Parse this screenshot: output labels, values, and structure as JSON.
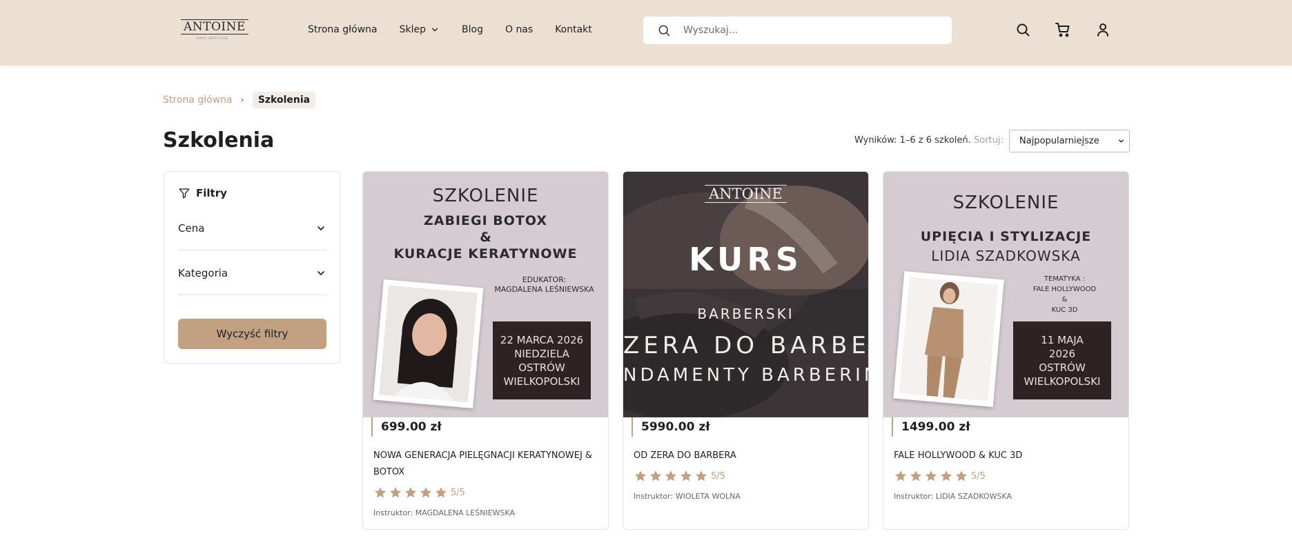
{
  "header": {
    "logo_text": "ANTOINE",
    "logo_subtext": "HAIR INSTITUTE",
    "nav": [
      "Strona główna",
      "Sklep",
      "Blog",
      "O nas",
      "Kontakt"
    ],
    "search_placeholder": "Wyszukaj...",
    "icons": [
      "search-icon",
      "cart-icon",
      "user-icon"
    ]
  },
  "breadcrumb": {
    "home": "Strona główna",
    "current": "Szkolenia"
  },
  "page_title": "Szkolenia",
  "toolbar": {
    "results_text": "Wyników: 1–6 z 6 szkoleń.",
    "sort_label": "Sortuj:",
    "sort_value": "Najpopularniejsze"
  },
  "filters": {
    "title": "Filtry",
    "price_label": "Cena",
    "category_label": "Kategoria",
    "clear_label": "Wyczyść filtry"
  },
  "colors": {
    "header_bg": "#ece0d3",
    "accent": "#c2a082",
    "star": "#c2a082"
  },
  "products": [
    {
      "price": "699.00 zł",
      "title": "NOWA GENERACJA PIELĘGNACJI KERATYNOWEJ & BOTOX",
      "rating": "5/5",
      "stars": 5,
      "instructor": "Instruktor: MAGDALENA LEŚNIEWSKA",
      "poster": {
        "heading": "SZKOLENIE",
        "line1": "ZABIEGI BOTOX",
        "line2": "&",
        "line3": "KURACJE KERATYNOWE",
        "educator_label": "EDUKATOR:",
        "educator_name": "MAGDALENA LEŚNIEWSKA",
        "date": [
          "22 MARCA 2026",
          "NIEDZIELA",
          "OSTRÓW",
          "WIELKOPOLSKI"
        ]
      }
    },
    {
      "price": "5990.00 zł",
      "title": "OD ZERA DO BARBERA",
      "rating": "5/5",
      "stars": 5,
      "instructor": "Instruktor: WIOLETA WOLNA",
      "poster": {
        "logo": "ANTOINE",
        "heading": "KURS",
        "line1": "BARBERSKI",
        "line2": "ZERA DO BARBE",
        "line3": "NDAMENTY BARBERIN"
      }
    },
    {
      "price": "1499.00 zł",
      "title": "FALE HOLLYWOOD & KUC 3D",
      "rating": "5/5",
      "stars": 5,
      "instructor": "Instruktor: LIDIA SZADKOWSKA",
      "poster": {
        "heading": "SZKOLENIE",
        "line1": "UPIĘCIA I STYLIZACJE",
        "line2": "LIDIA SZADKOWSKA",
        "topic_label": "TEMATYKA :",
        "topic_lines": [
          "FALE HOLLYWOOD",
          "&",
          "KUC 3D"
        ],
        "date": [
          "11 MAJA",
          "2026",
          "OSTRÓW",
          "WIELKOPOLSKI"
        ]
      }
    }
  ]
}
